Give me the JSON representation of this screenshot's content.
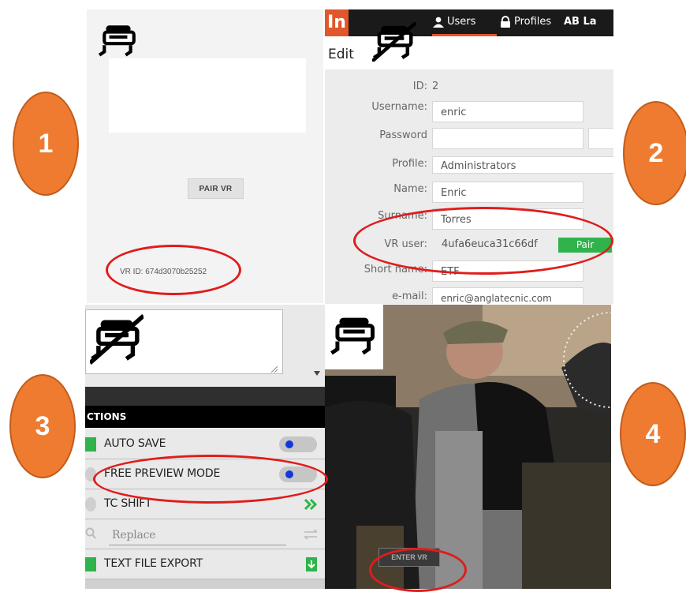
{
  "panel1": {
    "pair_button": "PAIR VR",
    "vr_id_label": "VR ID: 674d3070b25252"
  },
  "panel2": {
    "logo_letter": "In",
    "nav": {
      "users": "Users",
      "profiles": "Profiles",
      "languages": "AB La"
    },
    "page_title": "Edit",
    "form": {
      "id_label": "ID:",
      "id_value": "2",
      "username_label": "Username:",
      "username_value": "enric",
      "password_label": "Password",
      "profile_label": "Profile:",
      "profile_value": "Administrators",
      "name_label": "Name:",
      "name_value": "Enric",
      "surname_label": "Surname:",
      "surname_value": "Torres",
      "vr_user_label": "VR user:",
      "vr_user_value": "4ufa6euca31c66df",
      "pair_button": "Pair",
      "short_name_label": "Short name:",
      "short_name_value": "ETF",
      "email_label": "e-mail:",
      "email_value": "enric@anglatecnic.com"
    }
  },
  "panel3": {
    "section_header": "CTIONS",
    "items": [
      {
        "label": "AUTO SAVE",
        "control": "toggle"
      },
      {
        "label": "FREE PREVIEW MODE",
        "control": "toggle"
      },
      {
        "label": "TC SHIFT",
        "control": "chevrons"
      },
      {
        "label": "Replace",
        "control": "swap"
      },
      {
        "label": "TEXT FILE EXPORT",
        "control": "download"
      }
    ]
  },
  "panel4": {
    "enter_vr_button": "ENTER VR"
  },
  "markers": [
    "1",
    "2",
    "3",
    "4"
  ],
  "colors": {
    "marker_fill": "#ee7b30",
    "highlight_ellipse": "#e01c1c",
    "nav_accent": "#e2562b",
    "pair_green": "#2fb34a",
    "toggle_dot": "#1038d8"
  }
}
